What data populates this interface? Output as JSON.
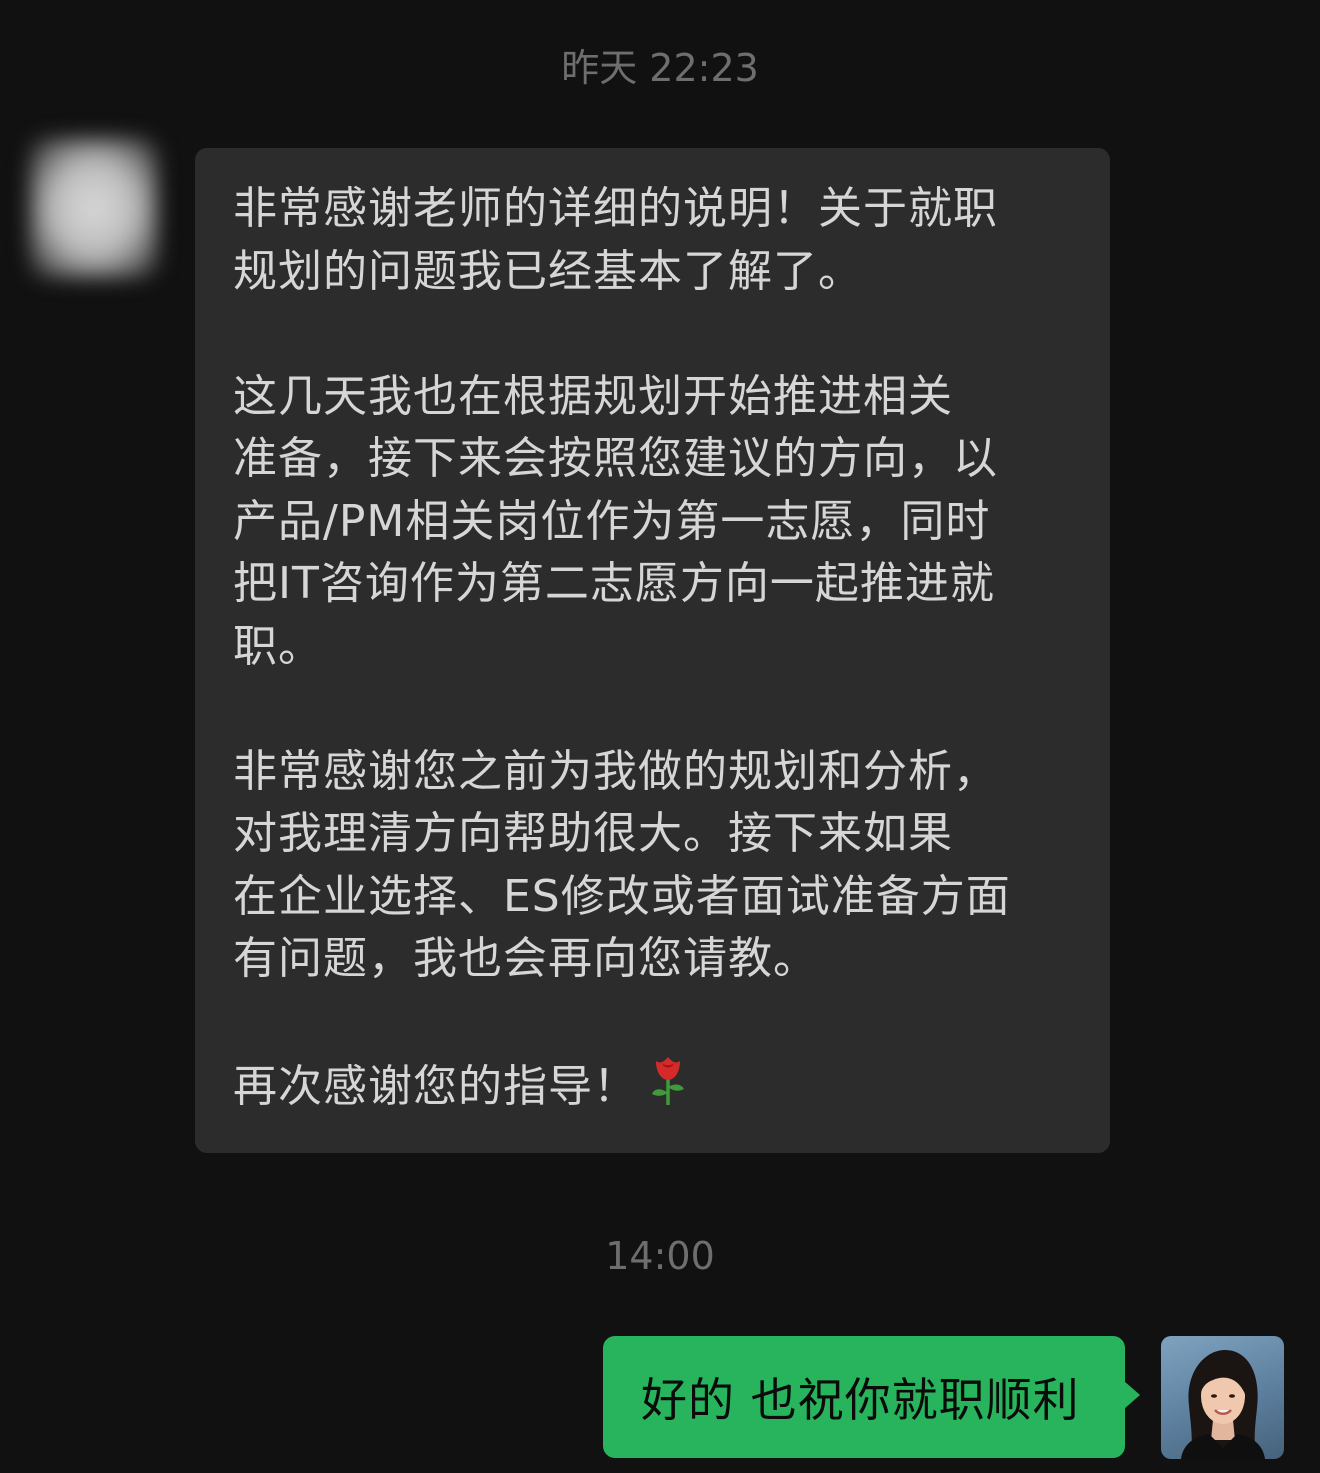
{
  "timestamps": {
    "first": "昨天 22:23",
    "second": "14:00"
  },
  "incoming_message": {
    "paragraphs": [
      "非常感谢老师的详细的说明！关于就职\n规划的问题我已经基本了解了。",
      "这几天我也在根据规划开始推进相关\n准备，接下来会按照您建议的方向，以\n产品/PM相关岗位作为第一志愿，同时\n把IT咨询作为第二志愿方向一起推进就\n职。",
      "非常感谢您之前为我做的规划和分析，\n对我理清方向帮助很大。接下来如果\n在企业选择、ES修改或者面试准备方面\n有问题，我也会再向您请教。",
      "再次感谢您的指导！"
    ],
    "emoji": "rose-icon"
  },
  "outgoing_message": {
    "text": "好的 也祝你就职顺利"
  },
  "colors": {
    "background": "#111111",
    "incoming_bubble": "#2c2c2c",
    "outgoing_bubble": "#28b45c",
    "timestamp_text": "#6e6e6e"
  }
}
